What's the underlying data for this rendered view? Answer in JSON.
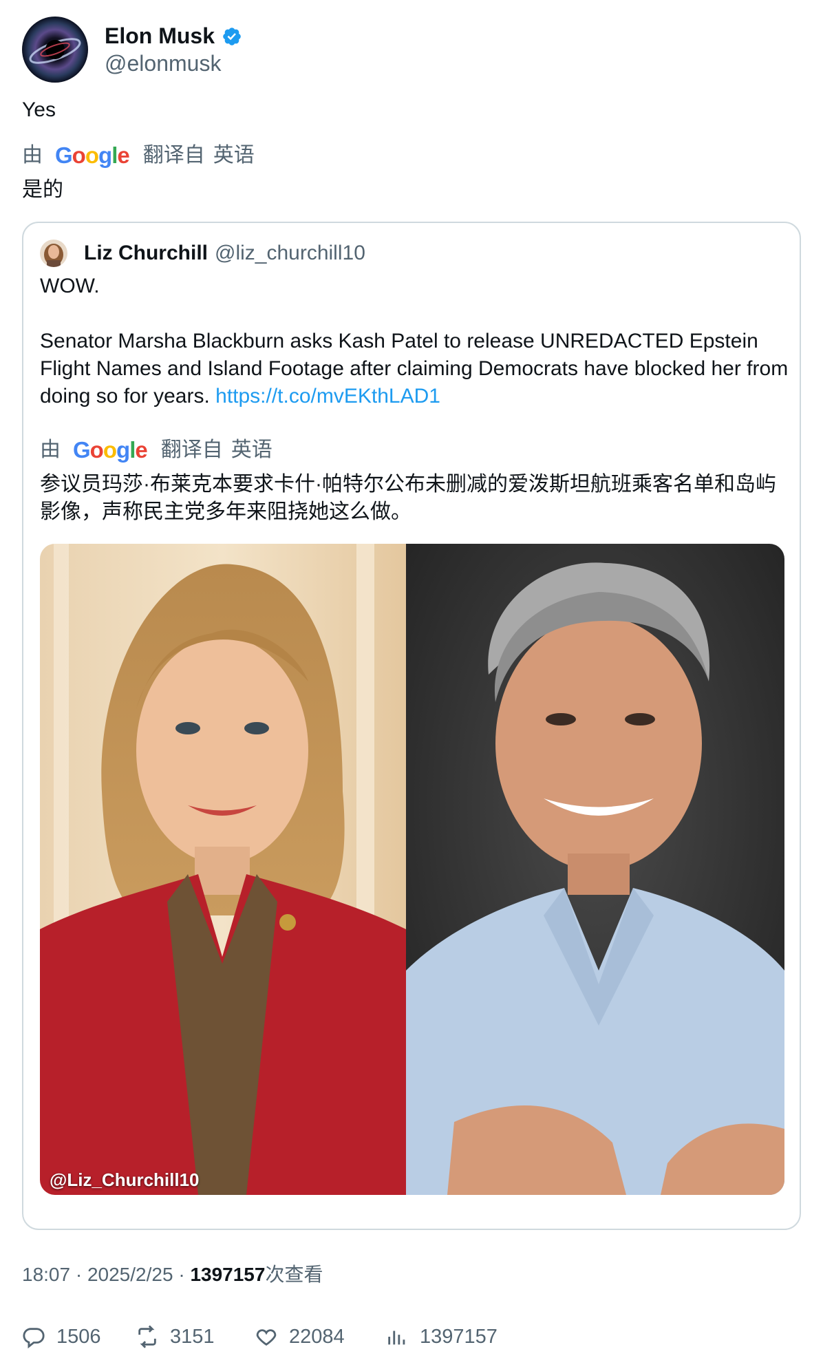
{
  "author": {
    "display_name": "Elon Musk",
    "handle": "@elonmusk",
    "verified_icon": "verified-badge-icon"
  },
  "tweet": {
    "text": "Yes",
    "translation": {
      "by": "由",
      "brand": "Google",
      "translated_from": "翻译自",
      "language": "英语",
      "text": "是的"
    }
  },
  "quoted": {
    "display_name": "Liz Churchill",
    "handle": "@liz_churchill10",
    "line1": "WOW.",
    "body": "Senator Marsha Blackburn asks Kash Patel to release UNREDACTED Epstein Flight Names and Island Footage after claiming Democrats have blocked her from doing so for years.",
    "link": "https://t.co/mvEKthLAD1",
    "translation": {
      "by": "由",
      "brand": "Google",
      "translated_from": "翻译自",
      "language": "英语",
      "text": "参议员玛莎·布莱克本要求卡什·帕特尔公布未删减的爱泼斯坦航班乘客名单和岛屿影像，声称民主党多年来阻挠她这么做。"
    },
    "media_watermark": "@Liz_Churchill10"
  },
  "meta": {
    "time": "18:07",
    "sep": "·",
    "date": "2025/2/25",
    "views": "1397157",
    "views_suffix": "次查看"
  },
  "actions": {
    "replies": "1506",
    "retweets": "3151",
    "likes": "22084",
    "views": "1397157"
  },
  "colors": {
    "link": "#1d9bf0",
    "secondary_text": "#536471",
    "border": "#cfd9de",
    "verified": "#1d9bf0"
  }
}
